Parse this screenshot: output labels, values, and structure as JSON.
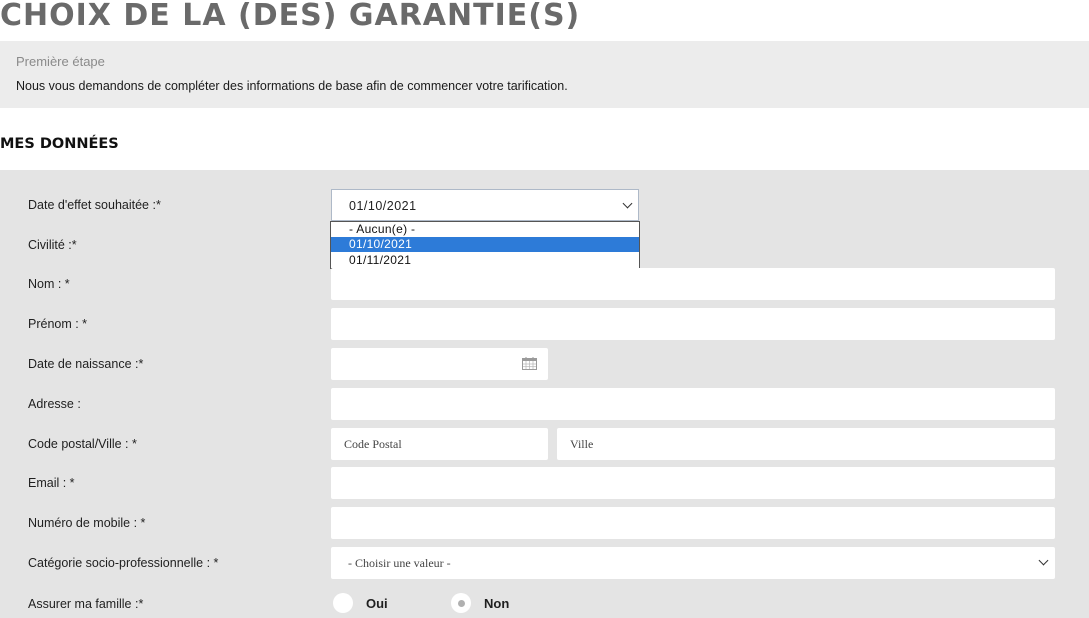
{
  "header": {
    "title": "CHOIX DE LA (DES) GARANTIE(S)"
  },
  "step": {
    "title": "Première étape",
    "text": "Nous vous demandons de compléter des informations de base afin de commencer votre tarification."
  },
  "section": {
    "title": "MES DONNÉES"
  },
  "form": {
    "date_effet": {
      "label": "Date d'effet souhaitée :*",
      "value": "01/10/2021",
      "options": [
        "- Aucun(e) -",
        "01/10/2021",
        "01/11/2021"
      ],
      "selected_index": 1,
      "expanded": true
    },
    "civilite": {
      "label": "Civilité :*"
    },
    "nom": {
      "label": "Nom : *",
      "value": ""
    },
    "prenom": {
      "label": "Prénom : *",
      "value": ""
    },
    "naissance": {
      "label": "Date de naissance :*",
      "value": "",
      "icon": "calendar-icon"
    },
    "adresse": {
      "label": "Adresse :",
      "value": ""
    },
    "code_ville": {
      "label": "Code postal/Ville : *",
      "code_placeholder": "Code Postal",
      "ville_placeholder": "Ville"
    },
    "email": {
      "label": "Email : *",
      "value": ""
    },
    "mobile": {
      "label": "Numéro de mobile : *",
      "value": ""
    },
    "csp": {
      "label": "Catégorie socio-professionnelle : *",
      "value": "- Choisir une valeur -"
    },
    "famille": {
      "label": "Assurer ma famille :*",
      "options": [
        "Oui",
        "Non"
      ],
      "selected": "Non"
    }
  },
  "colors": {
    "title_gray": "#6a6a6a",
    "form_bg": "#e4e4e4",
    "step_bg": "#ececec",
    "selection_blue": "#2d7bd8"
  }
}
